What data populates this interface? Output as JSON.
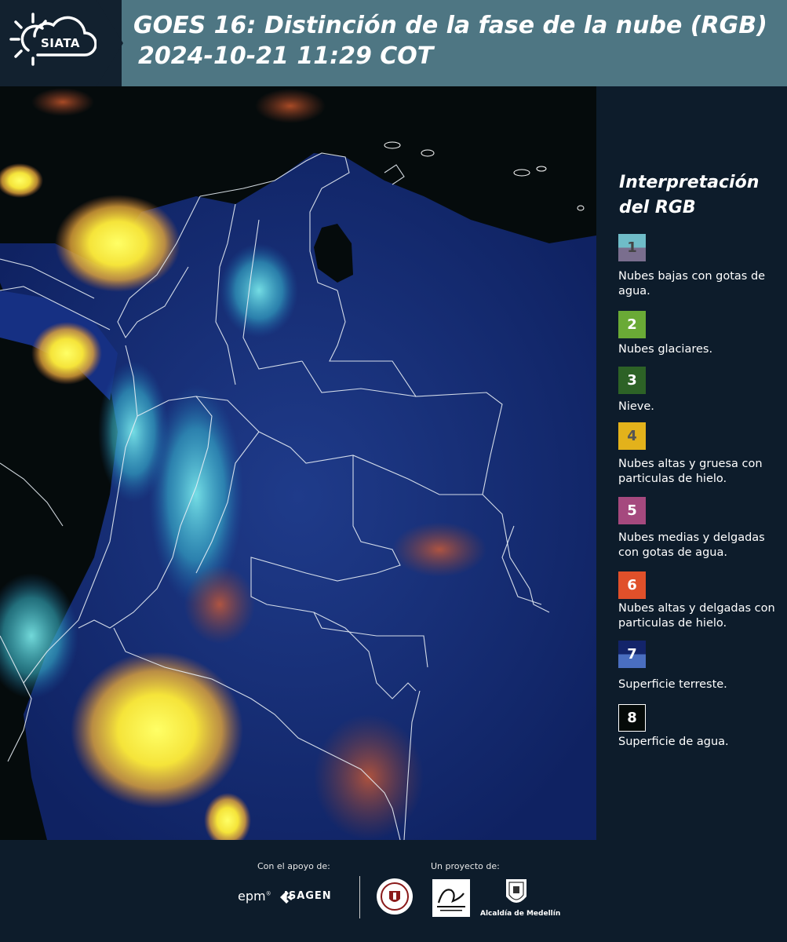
{
  "header": {
    "brand": "SIATA",
    "title": "GOES 16: Distinción de la fase de la nube (RGB)",
    "subtitle": "2024-10-21 11:29 COT"
  },
  "map": {
    "background_color": "#0a1840",
    "border_color": "#ffffff"
  },
  "legend": {
    "title_line1": "Interpretación",
    "title_line2": "del RGB",
    "items": [
      {
        "number": "1",
        "label": "Nubes bajas con gotas de agua.",
        "color_top": "#6fbcc8",
        "color_bottom": "#7a6e8e",
        "text_color": "#444444"
      },
      {
        "number": "2",
        "label": "Nubes glaciares.",
        "color_top": "#6aaa36",
        "color_bottom": "#6aaa36",
        "text_color": "#ffffff"
      },
      {
        "number": "3",
        "label": "Nieve.",
        "color_top": "#2d6226",
        "color_bottom": "#2d6226",
        "text_color": "#ffffff"
      },
      {
        "number": "4",
        "label": "Nubes altas y gruesa con particulas de hielo.",
        "color_top": "#e3b21b",
        "color_bottom": "#e3b21b",
        "text_color": "#555555"
      },
      {
        "number": "5",
        "label": "Nubes medias y delgadas con gotas de agua.",
        "color_top": "#a5497e",
        "color_bottom": "#a5497e",
        "text_color": "#ffffff"
      },
      {
        "number": "6",
        "label": "Nubes altas y delgadas con particulas de hielo.",
        "color_top": "#e0502a",
        "color_bottom": "#e0502a",
        "text_color": "#ffffff"
      },
      {
        "number": "7",
        "label": "Superficie terreste.",
        "color_top": "#13246a",
        "color_bottom": "#4a6ec0",
        "text_color": "#ffffff"
      },
      {
        "number": "8",
        "label": "Superficie de agua.",
        "color_top": "#050a08",
        "color_bottom": "#050a08",
        "text_color": "#ffffff"
      }
    ]
  },
  "footer": {
    "support_label": "Con el apoyo de:",
    "project_label": "Un proyecto de:",
    "sponsor1": "epm",
    "sponsor2": "ISAGEN",
    "partner_alcaldia": "Alcaldía de Medellín"
  }
}
